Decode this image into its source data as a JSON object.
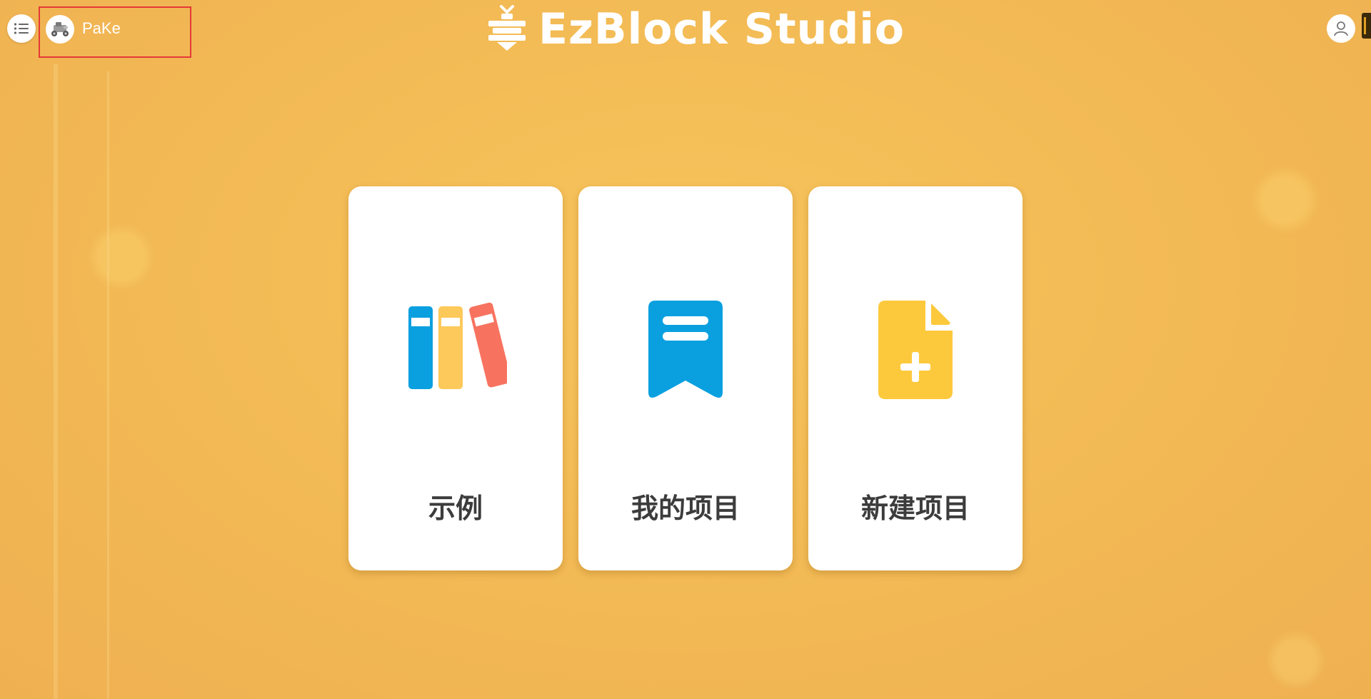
{
  "header": {
    "brand_title": "EzBlock Studio",
    "device": {
      "name": "PaKe",
      "avatar_icon": "robot-car-icon"
    },
    "menu_icon": "list-menu-icon",
    "user_icon": "user-account-icon"
  },
  "cards": [
    {
      "label": "示例",
      "icon": "books-icon"
    },
    {
      "label": "我的项目",
      "icon": "bookmark-icon"
    },
    {
      "label": "新建项目",
      "icon": "new-file-icon"
    }
  ],
  "colors": {
    "background": "#f3bb55",
    "card": "#ffffff",
    "card_text": "#3c3c3c",
    "book_blue": "#0aa0e0",
    "book_yellow": "#fcc95a",
    "book_red": "#f7735f",
    "bookmark_blue": "#0aa0e0",
    "newfile_yellow": "#fdc93c",
    "highlight_border": "#e53935"
  }
}
